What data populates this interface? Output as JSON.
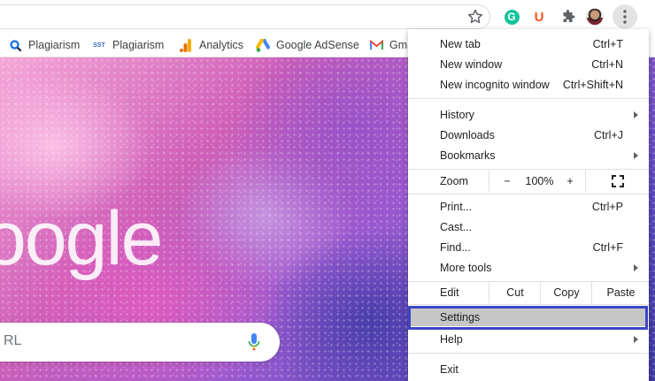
{
  "toolbar": {
    "star_icon": "star-outline-icon",
    "extensions": [
      {
        "name": "grammarly-icon",
        "glyph": "G",
        "color": "#15c39a"
      },
      {
        "name": "ublock-icon",
        "glyph": "U",
        "color": "#f4511e"
      }
    ],
    "puzzle_icon": "puzzle-icon",
    "menu_icon": "more-vertical-icon"
  },
  "bookmarks": [
    {
      "label": "Plagiarism",
      "icon": "plagiarism-search-icon"
    },
    {
      "label": "Plagiarism",
      "icon_text": "SST"
    },
    {
      "label": "Analytics",
      "icon": "analytics-icon"
    },
    {
      "label": "Google AdSense",
      "icon": "adsense-icon"
    },
    {
      "label": "Gm",
      "icon": "gmail-icon"
    }
  ],
  "page": {
    "logo_text": "oogle",
    "search_placeholder": "RL"
  },
  "menu": {
    "new_tab": {
      "label": "New tab",
      "shortcut": "Ctrl+T"
    },
    "new_window": {
      "label": "New window",
      "shortcut": "Ctrl+N"
    },
    "new_incognito": {
      "label": "New incognito window",
      "shortcut": "Ctrl+Shift+N"
    },
    "history": {
      "label": "History"
    },
    "downloads": {
      "label": "Downloads",
      "shortcut": "Ctrl+J"
    },
    "bookmarks": {
      "label": "Bookmarks"
    },
    "zoom": {
      "label": "Zoom",
      "minus": "−",
      "value": "100%",
      "plus": "+"
    },
    "print": {
      "label": "Print...",
      "shortcut": "Ctrl+P"
    },
    "cast": {
      "label": "Cast..."
    },
    "find": {
      "label": "Find...",
      "shortcut": "Ctrl+F"
    },
    "more_tools": {
      "label": "More tools"
    },
    "edit": {
      "label": "Edit",
      "cut": "Cut",
      "copy": "Copy",
      "paste": "Paste"
    },
    "settings": {
      "label": "Settings"
    },
    "help": {
      "label": "Help"
    },
    "exit": {
      "label": "Exit"
    }
  },
  "colors": {
    "highlight_outline": "#3d45c6",
    "hover_bg": "#c6c6c6"
  }
}
